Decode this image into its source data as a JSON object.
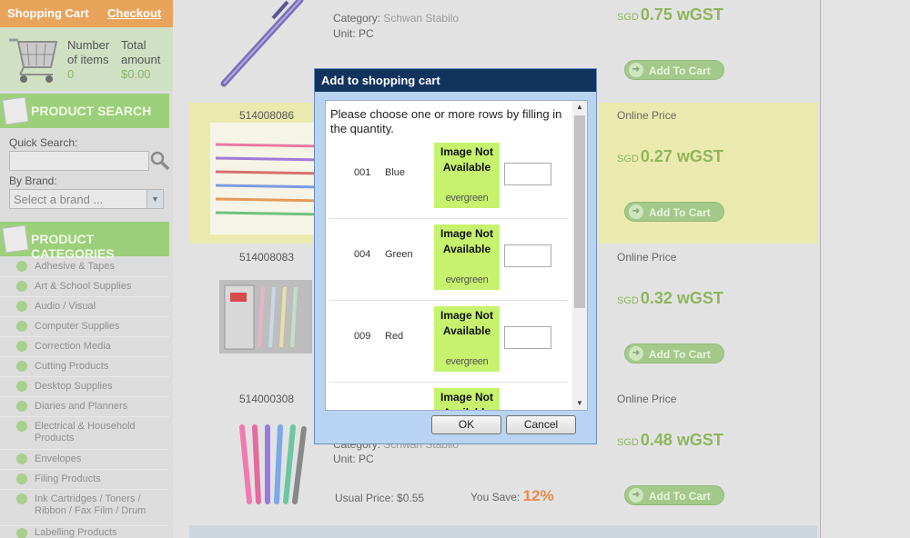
{
  "sidebar": {
    "cart": {
      "title": "Shopping Cart",
      "checkout": "Checkout",
      "items_label_1": "Number",
      "items_label_2": "of items",
      "items_value": "0",
      "amount_label_1": "Total",
      "amount_label_2": "amount",
      "amount_value": "$0.00"
    },
    "search": {
      "heading": "PRODUCT SEARCH",
      "quick_label": "Quick Search:",
      "brand_label": "By Brand:",
      "brand_placeholder": "Select a brand ..."
    },
    "categories": {
      "heading": "PRODUCT CATEGORIES",
      "items": [
        "Adhesive & Tapes",
        "Art & School Supplies",
        "Audio / Visual",
        "Computer Supplies",
        "Correction Media",
        "Cutting Products",
        "Desktop Supplies",
        "Diaries and Planners",
        "Electrical & Household Products",
        "Envelopes",
        "Filing Products",
        "Ink Cartridges / Toners / Ribbon / Fax Film / Drum",
        "Labelling Products"
      ]
    }
  },
  "products": [
    {
      "sku": "",
      "category_label": "Category:",
      "brand": "Schwan Stabilo",
      "unit": "Unit: PC",
      "online_label": "",
      "currency": "SGD",
      "price": "0.75 wGST",
      "add_label": "Add To Cart"
    },
    {
      "sku": "514008086",
      "online_label": "Online Price",
      "currency": "SGD",
      "price": "0.27 wGST",
      "add_label": "Add To Cart"
    },
    {
      "sku": "514008083",
      "online_label": "Online Price",
      "currency": "SGD",
      "price": "0.32 wGST",
      "add_label": "Add To Cart"
    },
    {
      "sku": "514000308",
      "category_label": "Category:",
      "brand": "Schwan Stabilo",
      "unit": "Unit: PC",
      "online_label": "Online Price",
      "currency": "SGD",
      "price": "0.48 wGST",
      "usual_label": "Usual Price:",
      "usual_value": "$0.55",
      "save_label": "You Save:",
      "save_value": "12%",
      "add_label": "Add To Cart"
    }
  ],
  "modal": {
    "title": "Add to shopping cart",
    "instruction": "Please choose one or more rows by filling in the quantity.",
    "image_text": "Image Not Available",
    "image_brand": "evergreen",
    "options": [
      {
        "code": "001",
        "name": "Blue"
      },
      {
        "code": "004",
        "name": "Green"
      },
      {
        "code": "009",
        "name": "Red"
      },
      {
        "code": "",
        "name": ""
      }
    ],
    "ok_label": "OK",
    "cancel_label": "Cancel"
  }
}
